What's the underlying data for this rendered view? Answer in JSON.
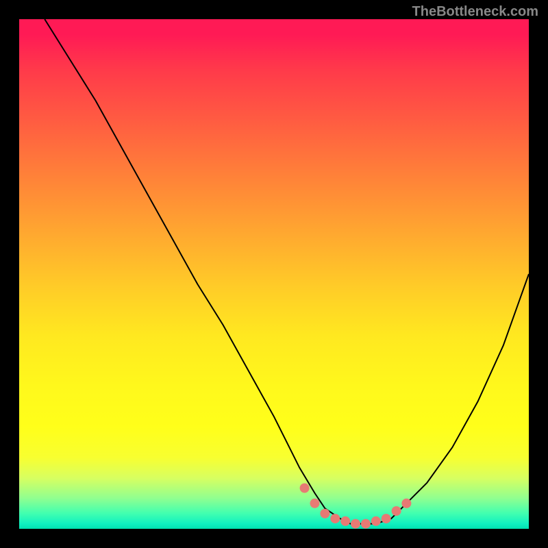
{
  "watermark": "TheBottleneck.com",
  "chart_data": {
    "type": "line",
    "title": "",
    "xlabel": "",
    "ylabel": "",
    "xlim": [
      0,
      100
    ],
    "ylim": [
      0,
      100
    ],
    "grid": false,
    "series": [
      {
        "name": "curve",
        "x": [
          5,
          10,
          15,
          20,
          25,
          30,
          35,
          40,
          45,
          50,
          52,
          55,
          58,
          60,
          63,
          65,
          68,
          70,
          73,
          75,
          80,
          85,
          90,
          95,
          100
        ],
        "y": [
          100,
          92,
          84,
          75,
          66,
          57,
          48,
          40,
          31,
          22,
          18,
          12,
          7,
          4,
          2,
          1,
          1,
          1,
          2,
          4,
          9,
          16,
          25,
          36,
          50
        ]
      },
      {
        "name": "dots",
        "x": [
          56,
          58,
          60,
          62,
          64,
          66,
          68,
          70,
          72,
          74,
          76
        ],
        "y": [
          8,
          5,
          3,
          2,
          1.5,
          1,
          1,
          1.5,
          2,
          3.5,
          5
        ]
      }
    ],
    "gradient_stops": [
      {
        "pos": 0,
        "color": "#ff1a55"
      },
      {
        "pos": 50,
        "color": "#ffca28"
      },
      {
        "pos": 80,
        "color": "#ffff1a"
      },
      {
        "pos": 100,
        "color": "#00e0b0"
      }
    ]
  }
}
